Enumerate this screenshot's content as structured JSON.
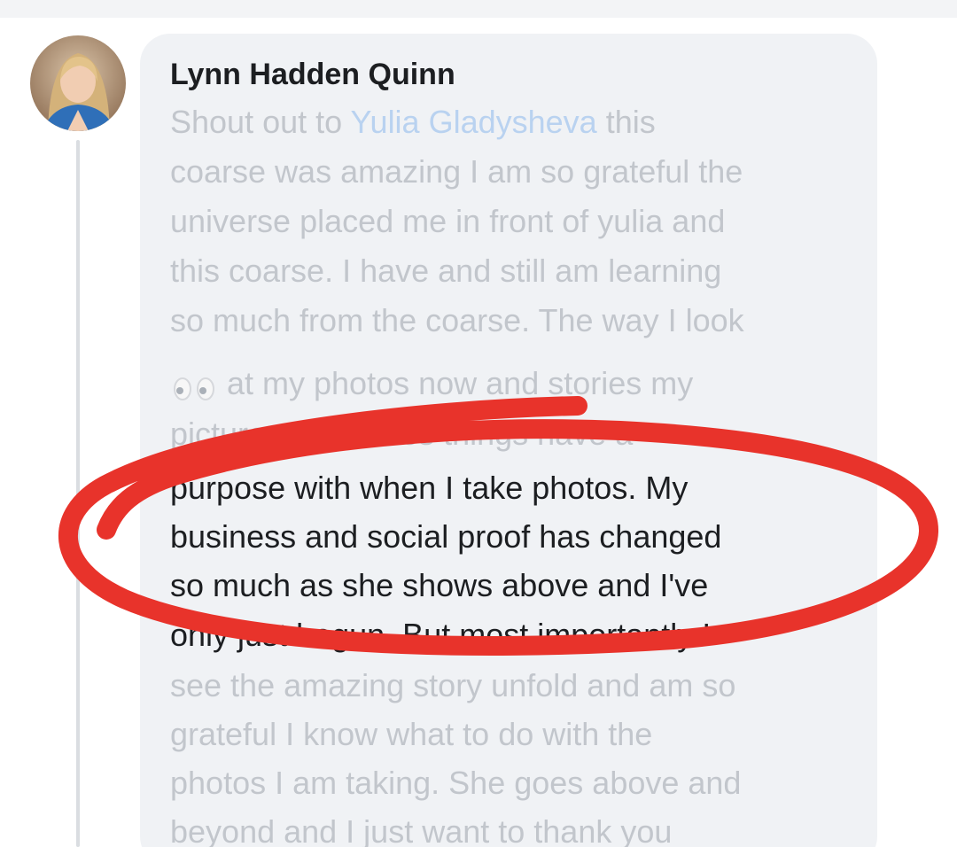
{
  "comment": {
    "author": "Lynn Hadden Quinn",
    "mention": "Yulia Gladysheva",
    "emoji_icon": "eyes-emoji-icon",
    "lines": [
      {
        "pre": "Shout out to ",
        "post": " this"
      },
      {
        "text": "coarse was amazing I am so grateful the"
      },
      {
        "text": "universe placed me in front of yulia and"
      },
      {
        "text": "this coarse. I have and still am learning"
      },
      {
        "text": "so much from the coarse. The way I look"
      },
      {
        "text": "at my photos now and stories my"
      },
      {
        "text": "pictures tell makes things have a"
      },
      {
        "text": "purpose with when I take photos. My"
      },
      {
        "text": "business and social proof has changed"
      },
      {
        "text": "so much as she shows above and I've"
      },
      {
        "text": "only just begun. But most importantly I"
      },
      {
        "text": "see the amazing story unfold and am so"
      },
      {
        "text": "grateful I know what to do with the"
      },
      {
        "text": "photos I am taking. She goes above and"
      },
      {
        "text": "beyond and I just want to thank you"
      }
    ]
  },
  "colors": {
    "highlight_circle": "#e8332b",
    "bubble_background": "#f0f2f5",
    "faded_text": "#c2c6cc",
    "dark_text": "#1c1e21",
    "mention_text": "#b9d2f0"
  }
}
